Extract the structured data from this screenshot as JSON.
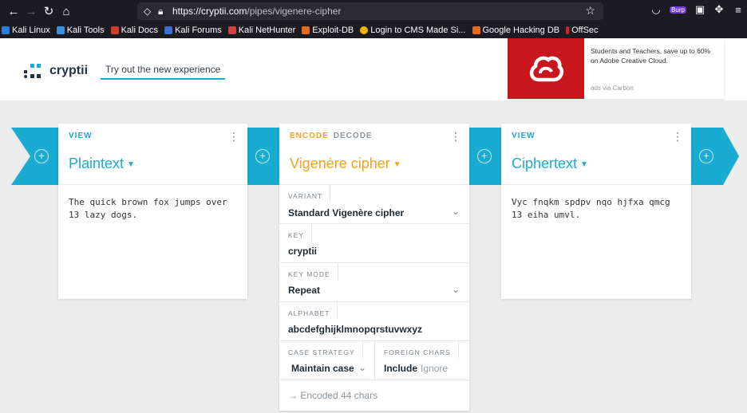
{
  "browser": {
    "url_host": "https://cryptii.com",
    "url_path": "/pipes/vigenere-cipher",
    "bookmarks": [
      "Kali Linux",
      "Kali Tools",
      "Kali Docs",
      "Kali Forums",
      "Kali NetHunter",
      "Exploit-DB",
      "Login to CMS Made Si...",
      "Google Hacking DB",
      "OffSec"
    ],
    "burp_label": "Burp"
  },
  "header": {
    "logo_text": "cryptii",
    "try_link": "Try out the new experience"
  },
  "ad": {
    "text": "Students and Teachers, save up to 60% on Adobe Creative Cloud.",
    "via": "ads via Carbon"
  },
  "plaintext_brick": {
    "type": "VIEW",
    "title": "Plaintext",
    "content": "The quick brown fox jumps over 13 lazy dogs."
  },
  "cipher_brick": {
    "tab_encode": "ENCODE",
    "tab_decode": "DECODE",
    "title": "Vigenère cipher",
    "variant_label": "VARIANT",
    "variant_value": "Standard Vigenère cipher",
    "key_label": "KEY",
    "key_value": "cryptii",
    "key_mode_label": "KEY MODE",
    "key_mode_value": "Repeat",
    "alphabet_label": "ALPHABET",
    "alphabet_value": "abcdefghijklmnopqrstuvwxyz",
    "case_label": "CASE STRATEGY",
    "case_value": "Maintain case",
    "foreign_label": "FOREIGN CHARS",
    "foreign_include": "Include",
    "foreign_ignore": "Ignore",
    "status": "Encoded 44 chars"
  },
  "ciphertext_brick": {
    "type": "VIEW",
    "title": "Ciphertext",
    "content": "Vyc fnqkm spdpv nqo hjfxa qmcg 13 eiha umvl."
  },
  "colors": {
    "accent": "#19abd0",
    "encoder": "#f7a21a"
  }
}
